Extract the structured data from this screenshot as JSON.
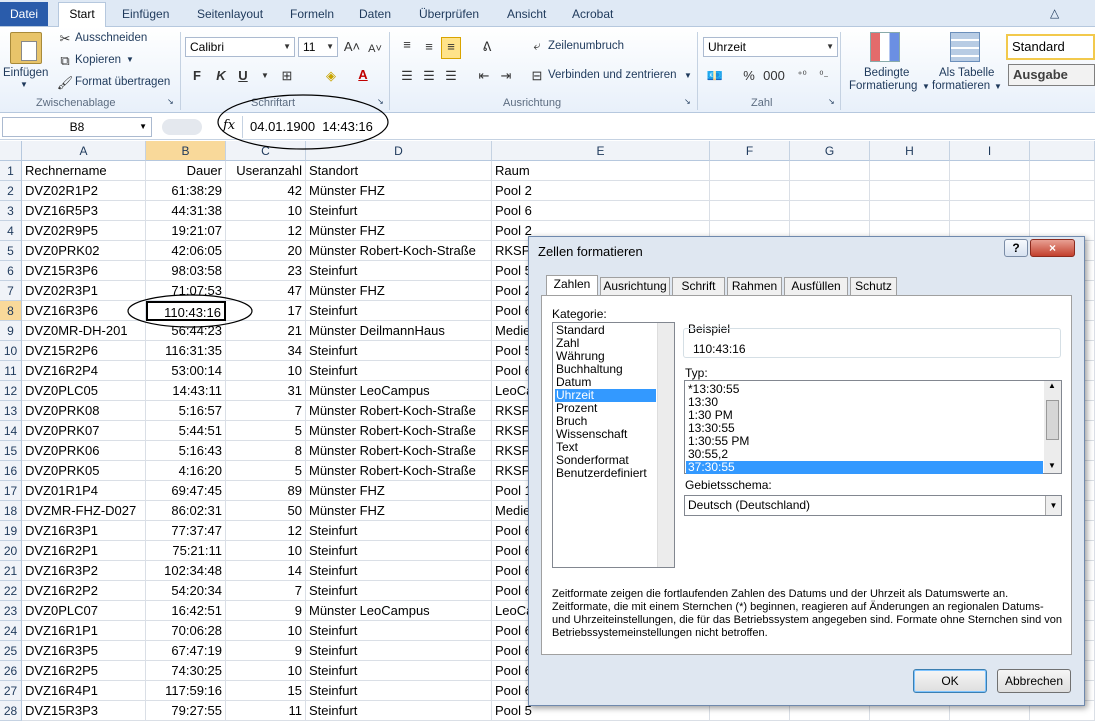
{
  "ribbon": {
    "tabs": [
      "Datei",
      "Start",
      "Einfügen",
      "Seitenlayout",
      "Formeln",
      "Daten",
      "Überprüfen",
      "Ansicht",
      "Acrobat"
    ],
    "clipboard": {
      "paste": "Einfügen",
      "cut": "Ausschneiden",
      "copy": "Kopieren",
      "format_painter": "Format übertragen",
      "label": "Zwischenablage"
    },
    "font": {
      "name": "Calibri",
      "size": "11",
      "bold": "F",
      "italic": "K",
      "underline": "U",
      "label": "Schriftart"
    },
    "alignment": {
      "wrap": "Zeilenumbruch",
      "merge": "Verbinden und zentrieren",
      "label": "Ausrichtung"
    },
    "number": {
      "format": "Uhrzeit",
      "percent": "%",
      "thousands": "000",
      "label": "Zahl"
    },
    "styles": {
      "cond_l1": "Bedingte",
      "cond_l2": "Formatierung",
      "table_l1": "Als Tabelle",
      "table_l2": "formatieren",
      "style1": "Standard",
      "style2": "Ausgabe"
    }
  },
  "formula_bar": {
    "name_box": "B8",
    "fx": "fx",
    "value": "04.01.1900  14:43:16"
  },
  "columns": [
    "A",
    "B",
    "C",
    "D",
    "E",
    "F",
    "G",
    "H",
    "I"
  ],
  "rows": [
    [
      "1",
      "Rechnername",
      "Dauer",
      "Useranzahl",
      "Standort",
      "Raum"
    ],
    [
      "2",
      "DVZ02R1P2",
      "61:38:29",
      "42",
      "Münster FHZ",
      "Pool 2"
    ],
    [
      "3",
      "DVZ16R5P3",
      "44:31:38",
      "10",
      "Steinfurt",
      "Pool 6"
    ],
    [
      "4",
      "DVZ02R9P5",
      "19:21:07",
      "12",
      "Münster FHZ",
      "Pool 2"
    ],
    [
      "5",
      "DVZ0PRK02",
      "42:06:05",
      "20",
      "Münster Robert-Koch-Straße",
      "RKSPo"
    ],
    [
      "6",
      "DVZ15R3P6",
      "98:03:58",
      "23",
      "Steinfurt",
      "Pool 5"
    ],
    [
      "7",
      "DVZ02R3P1",
      "71:07:53",
      "47",
      "Münster FHZ",
      "Pool 2"
    ],
    [
      "8",
      "DVZ16R3P6",
      "110:43:16",
      "17",
      "Steinfurt",
      "Pool 6"
    ],
    [
      "9",
      "DVZ0MR-DH-201",
      "56:44:23",
      "21",
      "Münster DeilmannHaus",
      "Medie"
    ],
    [
      "10",
      "DVZ15R2P6",
      "116:31:35",
      "34",
      "Steinfurt",
      "Pool 5"
    ],
    [
      "11",
      "DVZ16R2P4",
      "53:00:14",
      "10",
      "Steinfurt",
      "Pool 6"
    ],
    [
      "12",
      "DVZ0PLC05",
      "14:43:11",
      "31",
      "Münster LeoCampus",
      "LeoCa"
    ],
    [
      "13",
      "DVZ0PRK08",
      "5:16:57",
      "7",
      "Münster Robert-Koch-Straße",
      "RKSPo"
    ],
    [
      "14",
      "DVZ0PRK07",
      "5:44:51",
      "5",
      "Münster Robert-Koch-Straße",
      "RKSPo"
    ],
    [
      "15",
      "DVZ0PRK06",
      "5:16:43",
      "8",
      "Münster Robert-Koch-Straße",
      "RKSPo"
    ],
    [
      "16",
      "DVZ0PRK05",
      "4:16:20",
      "5",
      "Münster Robert-Koch-Straße",
      "RKSPo"
    ],
    [
      "17",
      "DVZ01R1P4",
      "69:47:45",
      "89",
      "Münster FHZ",
      "Pool 1"
    ],
    [
      "18",
      "DVZMR-FHZ-D027",
      "86:02:31",
      "50",
      "Münster FHZ",
      "Medie"
    ],
    [
      "19",
      "DVZ16R3P1",
      "77:37:47",
      "12",
      "Steinfurt",
      "Pool 6"
    ],
    [
      "20",
      "DVZ16R2P1",
      "75:21:11",
      "10",
      "Steinfurt",
      "Pool 6"
    ],
    [
      "21",
      "DVZ16R3P2",
      "102:34:48",
      "14",
      "Steinfurt",
      "Pool 6"
    ],
    [
      "22",
      "DVZ16R2P2",
      "54:20:34",
      "7",
      "Steinfurt",
      "Pool 6"
    ],
    [
      "23",
      "DVZ0PLC07",
      "16:42:51",
      "9",
      "Münster LeoCampus",
      "LeoCa"
    ],
    [
      "24",
      "DVZ16R1P1",
      "70:06:28",
      "10",
      "Steinfurt",
      "Pool 6"
    ],
    [
      "25",
      "DVZ16R3P5",
      "67:47:19",
      "9",
      "Steinfurt",
      "Pool 6"
    ],
    [
      "26",
      "DVZ16R2P5",
      "74:30:25",
      "10",
      "Steinfurt",
      "Pool 6"
    ],
    [
      "27",
      "DVZ16R4P1",
      "117:59:16",
      "15",
      "Steinfurt",
      "Pool 6"
    ],
    [
      "28",
      "DVZ15R3P3",
      "79:27:55",
      "11",
      "Steinfurt",
      "Pool 5"
    ]
  ],
  "dialog": {
    "title": "Zellen formatieren",
    "help": "?",
    "close": "×",
    "tabs": [
      "Zahlen",
      "Ausrichtung",
      "Schrift",
      "Rahmen",
      "Ausfüllen",
      "Schutz"
    ],
    "category_label": "Kategorie:",
    "categories": [
      "Standard",
      "Zahl",
      "Währung",
      "Buchhaltung",
      "Datum",
      "Uhrzeit",
      "Prozent",
      "Bruch",
      "Wissenschaft",
      "Text",
      "Sonderformat",
      "Benutzerdefiniert"
    ],
    "selected_category": "Uhrzeit",
    "sample_label": "Beispiel",
    "sample_value": "110:43:16",
    "type_label": "Typ:",
    "types": [
      "*13:30:55",
      "13:30",
      "1:30 PM",
      "13:30:55",
      "1:30:55 PM",
      "30:55,2",
      "37:30:55"
    ],
    "selected_type": "37:30:55",
    "locale_label": "Gebietsschema:",
    "locale_value": "Deutsch (Deutschland)",
    "description": "Zeitformate zeigen die fortlaufenden Zahlen des Datums und der Uhrzeit als Datumswerte an. Zeitformate, die mit einem Sternchen (*) beginnen, reagieren auf Änderungen an regionalen Datums- und Uhrzeiteinstellungen, die für das Betriebssystem angegeben sind. Formate ohne Sternchen sind von Betriebssystemeinstellungen nicht betroffen.",
    "ok": "OK",
    "cancel": "Abbrechen"
  }
}
